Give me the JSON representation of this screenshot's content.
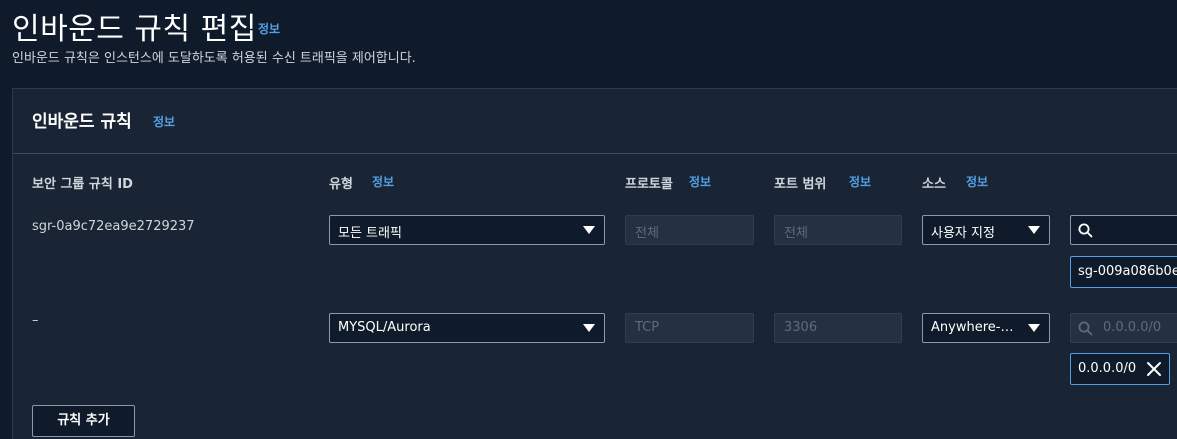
{
  "page": {
    "title": "인바운드 규칙 편집",
    "info_link": "정보",
    "description": "인바운드 규칙은 인스턴스에 도달하도록 허용된 수신 트래픽을 제어합니다."
  },
  "panel": {
    "title": "인바운드 규칙",
    "info_link": "정보",
    "columns": {
      "rule_id": "보안 그룹 규칙 ID",
      "type": "유형",
      "type_info": "정보",
      "protocol": "프로토콜",
      "protocol_info": "정보",
      "port_range": "포트 범위",
      "port_range_info": "정보",
      "source": "소스",
      "source_info": "정보"
    },
    "rules": [
      {
        "rule_id": "sgr-0a9c72ea9e2729237",
        "type": "모든 트래픽",
        "protocol": "전체",
        "port_range": "전체",
        "source": "사용자 지정",
        "search_placeholder": "",
        "token": "sg-009a086b0e"
      },
      {
        "rule_id": "–",
        "type": "MYSQL/Aurora",
        "protocol": "TCP",
        "port_range": "3306",
        "source": "Anywhere-…",
        "search_placeholder": "0.0.0.0/0",
        "token": "0.0.0.0/0"
      }
    ],
    "add_rule_label": "규칙 추가"
  },
  "colors": {
    "background": "#0f1b2a",
    "panel": "#192534",
    "link": "#539fe5",
    "token_border": "#539fe5"
  }
}
